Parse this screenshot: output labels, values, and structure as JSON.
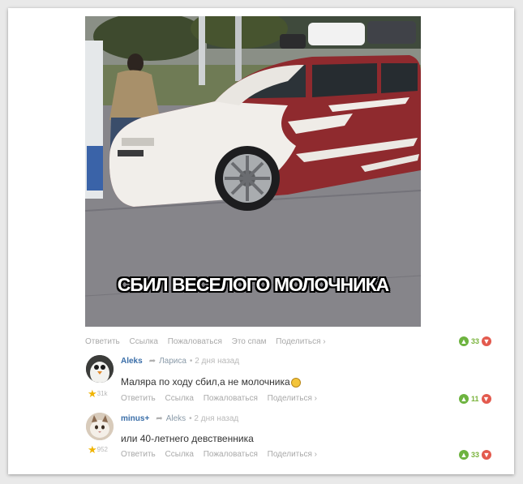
{
  "post": {
    "caption": "СБИЛ ВЕСЕЛОГО МОЛОЧНИКА",
    "actions": [
      "Ответить",
      "Ссылка",
      "Пожаловаться",
      "Это спам",
      "Поделиться ›"
    ],
    "votes": "33"
  },
  "comments": [
    {
      "author": "Aleks",
      "reply_to": "Лариса",
      "time": "• 2 дня назад",
      "text": "Маляра по ходу сбил,а не молочника",
      "karma": "31k",
      "actions": [
        "Ответить",
        "Ссылка",
        "Пожаловаться",
        "Поделиться ›"
      ],
      "votes": "11"
    },
    {
      "author": "minus+",
      "reply_to": "Aleks",
      "time": "• 2 дня назад",
      "text": "или 40-летнего девственника",
      "karma": "952",
      "actions": [
        "Ответить",
        "Ссылка",
        "Пожаловаться",
        "Поделиться ›"
      ],
      "votes": "33"
    }
  ],
  "icons": {
    "upvote": "thumbs-up-icon",
    "downvote": "thumbs-down-icon",
    "reply": "reply-arrow-icon",
    "karma": "star-icon"
  },
  "colors": {
    "link": "#3a6ea8",
    "upvote": "#6db33f",
    "downvote": "#e35a4e",
    "muted": "#a9a9a9"
  }
}
